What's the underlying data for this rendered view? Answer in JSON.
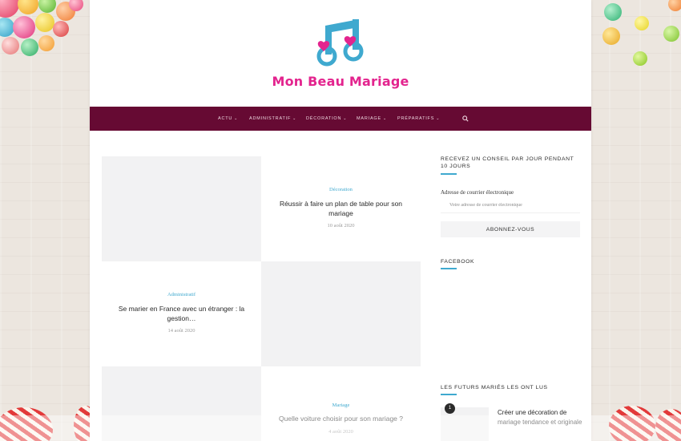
{
  "site": {
    "name": "Mon Beau Mariage",
    "logo_icon": "music-notes-hearts-icon",
    "brand_color": "#e3248e",
    "accent_color": "#3fa9cf",
    "nav_color": "#660a33"
  },
  "nav": {
    "items": [
      {
        "label": "Actu"
      },
      {
        "label": "Administratif"
      },
      {
        "label": "Décoration"
      },
      {
        "label": "Mariage"
      },
      {
        "label": "Préparatifs"
      }
    ],
    "search_icon": "search-icon"
  },
  "posts": [
    {
      "category": "Décoration",
      "title": "Réussir à faire un plan de table pour son mariage",
      "date": "10 août 2020"
    },
    {
      "category": "Administratif",
      "title": "Se marier en France avec un étranger : la gestion…",
      "date": "14 août 2020"
    },
    {
      "category": "Mariage",
      "title": "Quelle voiture choisir pour son mariage ?",
      "date": "4 août 2020"
    }
  ],
  "sidebar": {
    "newsletter": {
      "title": "Recevez un conseil par jour pendant 10 jours",
      "email_label": "Adresse de courrier électronique",
      "email_placeholder": "Votre adresse de courrier électronique",
      "button_label": "Abonnez-vous"
    },
    "facebook": {
      "title": "Facebook"
    },
    "popular": {
      "title": "Les futurs mariés les ont lus",
      "items": [
        {
          "rank": "1",
          "title": "Créer une décoration de mariage tendance et originale"
        }
      ]
    }
  }
}
